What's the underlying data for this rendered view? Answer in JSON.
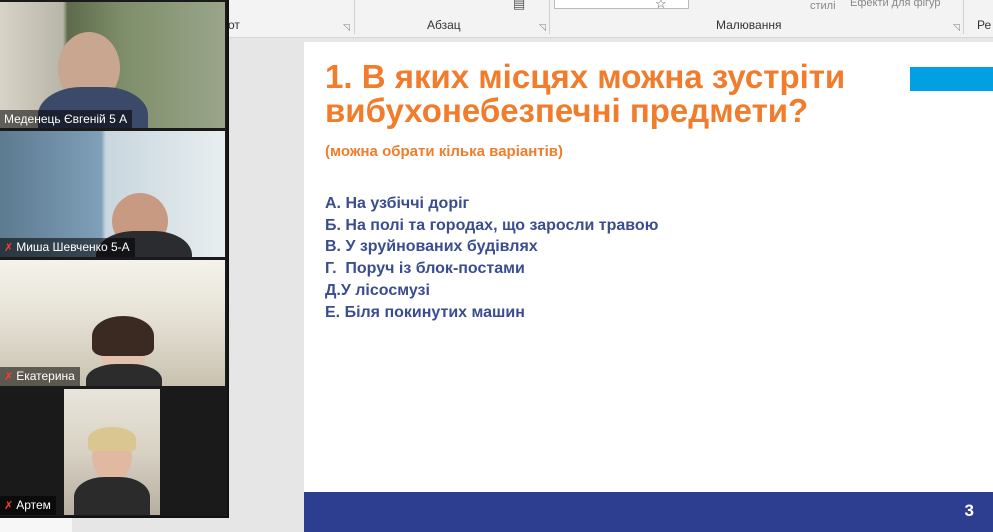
{
  "ribbon": {
    "partial_left": "от",
    "paragraph_label": "Абзац",
    "drawing_label": "Малювання",
    "styles_text": "стилі",
    "shape_effects_text": "Ефекти для фігур",
    "partial_right": "Ре"
  },
  "participants": [
    {
      "name": "Меденець Євгеній 5 А",
      "muted": false
    },
    {
      "name": "Миша Шевченко 5-А",
      "muted": true
    },
    {
      "name": "Екатерина",
      "muted": true
    },
    {
      "name": "Артем",
      "muted": true
    }
  ],
  "slide": {
    "title": "1. В яких місцях можна зустріти вибухонебезпечні предмети?",
    "subtitle": "(можна обрати кілька варіантів)",
    "options": [
      "А. На узбіччі доріг",
      "Б. На полі та городах, що заросли травою",
      "В. У зруйнованих будівлях",
      "Г.  Поруч із блок-постами",
      "Д.У лісосмузі",
      "Е. Біля покинутих машин"
    ],
    "number": "3"
  },
  "colors": {
    "title": "#f07c2c",
    "options": "#3a4d8f",
    "footer": "#2d3e91",
    "accent": "#00a0e3"
  },
  "icons": {
    "muted_mic": "muted-microphone-icon"
  }
}
